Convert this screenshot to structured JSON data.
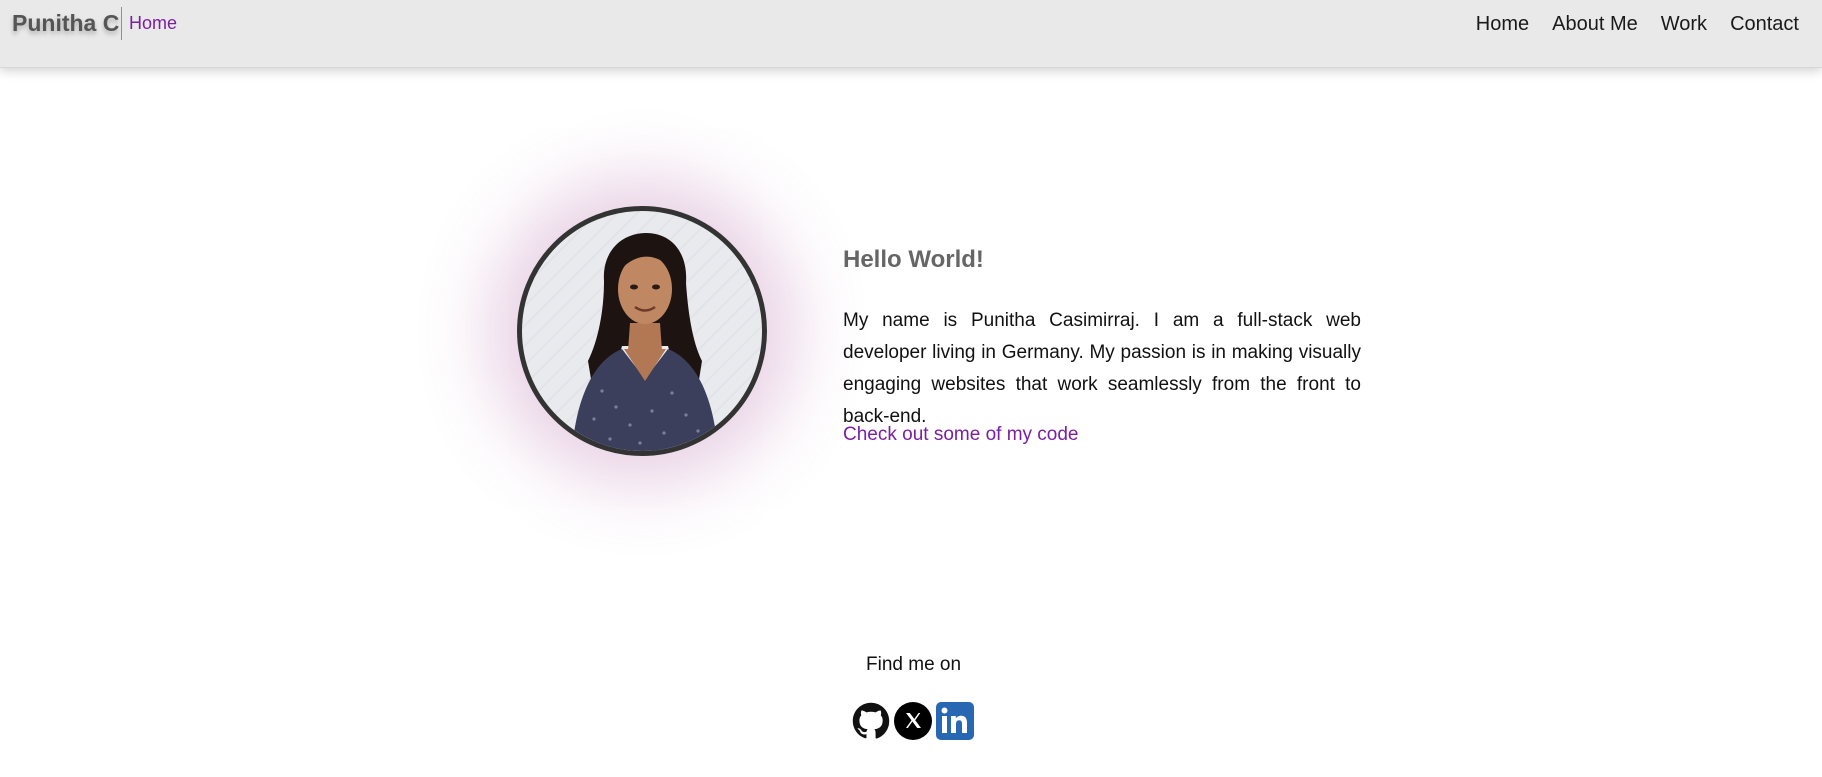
{
  "header": {
    "brand": "Punitha C",
    "breadcrumb": "Home",
    "nav": [
      "Home",
      "About Me",
      "Work",
      "Contact"
    ]
  },
  "hero": {
    "greeting": "Hello World!",
    "bio": "My name is Punitha Casimirraj. I am a full-stack web developer living in Germany. My passion is in making visually engaging websites that work seamlessly from the front to back-end.",
    "code_link": "Check out some of my code",
    "avatar_icon": "profile-photo"
  },
  "footer": {
    "find_label": "Find me on",
    "social_icons": [
      "github-icon",
      "x-icon",
      "linkedin-icon"
    ]
  },
  "colors": {
    "accent": "#7b1fa2",
    "header_bg": "#e9e9e9",
    "linkedin": "#2867b2",
    "glow": "#b362a5"
  }
}
